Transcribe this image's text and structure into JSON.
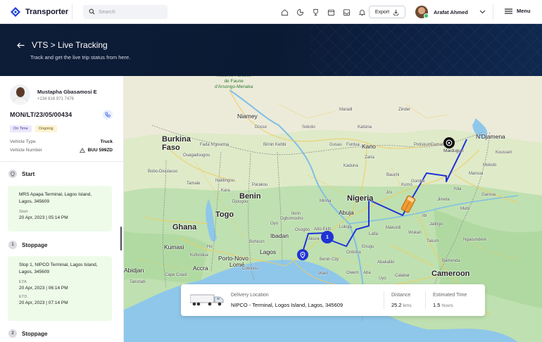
{
  "brand": {
    "name": "Transporter"
  },
  "search": {
    "placeholder": "Search"
  },
  "toolbar": {
    "export_label": "Export"
  },
  "user": {
    "name": "Arafat Ahmed"
  },
  "menu": {
    "label": "Menu"
  },
  "hero": {
    "title": "VTS > Live Tracking",
    "subtitle": "Track and get the live trip status from here."
  },
  "driver": {
    "name": "Mustapha Gbasamosi E",
    "phone": "+234 816 971 7476"
  },
  "trip": {
    "id": "MON/LT/23/05/00434",
    "badges": [
      "On Time",
      "Ongoing"
    ],
    "vehicle_type_label": "Vehicle Type",
    "vehicle_type": "Truck",
    "vehicle_number_label": "Vehicle Number",
    "vehicle_number": "BUU 599ZD"
  },
  "timeline": {
    "start": {
      "title": "Start",
      "address": "MRS Apapa Terminal, Lagos Island, Lagos, 345609",
      "time_label": "Start",
      "time": "20 Apr, 2023 | 05:14 PM"
    },
    "stoppage1": {
      "num": "1",
      "title": "Stoppage",
      "address": "Stop 1, NIPCO Terminal, Lagos Island, Lagos, 345609",
      "eta_label": "ETA",
      "eta": "20 Apr, 2023 | 06:14 PM",
      "etd_label": "ETD",
      "etd": "20 Apr, 2023 | 07:14 PM"
    },
    "stoppage2": {
      "num": "2",
      "title": "Stoppage"
    }
  },
  "map": {
    "countries": {
      "burkina": "Burkina\nFaso",
      "nigeria": "Nigeria",
      "benin": "Benin",
      "togo": "Togo",
      "ghana": "Ghana",
      "cameroon": "Cameroon"
    },
    "cities": {
      "niamey": "Niamey",
      "kano": "Kano",
      "abuja": "Abuja",
      "ibadan": "Ibadan",
      "lagos": "Lagos",
      "porto_novo": "Porto-Novo",
      "lome": "Lomé",
      "accra": "Accra",
      "kumasi": "Kumasi",
      "abidjan": "Abidjan",
      "ndjamena": "N'Djamena",
      "maiduguri": "Maiduguri"
    },
    "park": "Réserve Partielle\nde Faune\nd'Arsongo-Menaka",
    "towns": [
      "Dosso",
      "Maradi",
      "Zinder",
      "Sokoto",
      "Katsina",
      "Kaduna",
      "Zaria",
      "Bauchi",
      "Gombe",
      "Jos",
      "Yola",
      "Jimeta",
      "Makurdi",
      "Enugu",
      "Onitsha",
      "Benin City",
      "Warri",
      "Owerri",
      "Aba",
      "Uyo",
      "Calabar",
      "Akure",
      "Ilorin",
      "Oyo",
      "Osogbo",
      "Ado-Ekiti",
      "Ogbomosho",
      "Tamale",
      "Bobo-Dioulasso",
      "Ouagadougou",
      "Fada N'gourma",
      "Kara",
      "Parakou",
      "Djougou",
      "Natitingou",
      "Bohicon",
      "Cotonou",
      "Takoradi",
      "Cape Coast",
      "Koforidua",
      "Ho",
      "Garoua",
      "Maroua",
      "Mokolo",
      "Ngaoundéré",
      "Birnin Kebbi",
      "Gusau",
      "Funtua",
      "Potiskum",
      "Damaturu",
      "Kumo",
      "Lafia",
      "Minna",
      "Lokoja",
      "Ibi",
      "Wukari",
      "Takum",
      "Abakaliki",
      "Bamenda",
      "Kousseri",
      "Jalingo",
      "Mubi"
    ],
    "route_marker_label": "1"
  },
  "delivery": {
    "location_label": "Delivery Location",
    "location": "NIPCO - Terminal, Logos Island, Lagos, 345609",
    "distance_label": "Distance",
    "distance_value": "25.2",
    "distance_unit": "kms",
    "time_label": "Estimated Time",
    "time_value": "1.5",
    "time_unit": "hours"
  },
  "colors": {
    "accent": "#2450e6",
    "route": "#1f33d6",
    "hero_bg": "#0d1d38",
    "green_card": "#eefbe9",
    "water": "#8fc7ea",
    "land": "#cfe6c4"
  }
}
